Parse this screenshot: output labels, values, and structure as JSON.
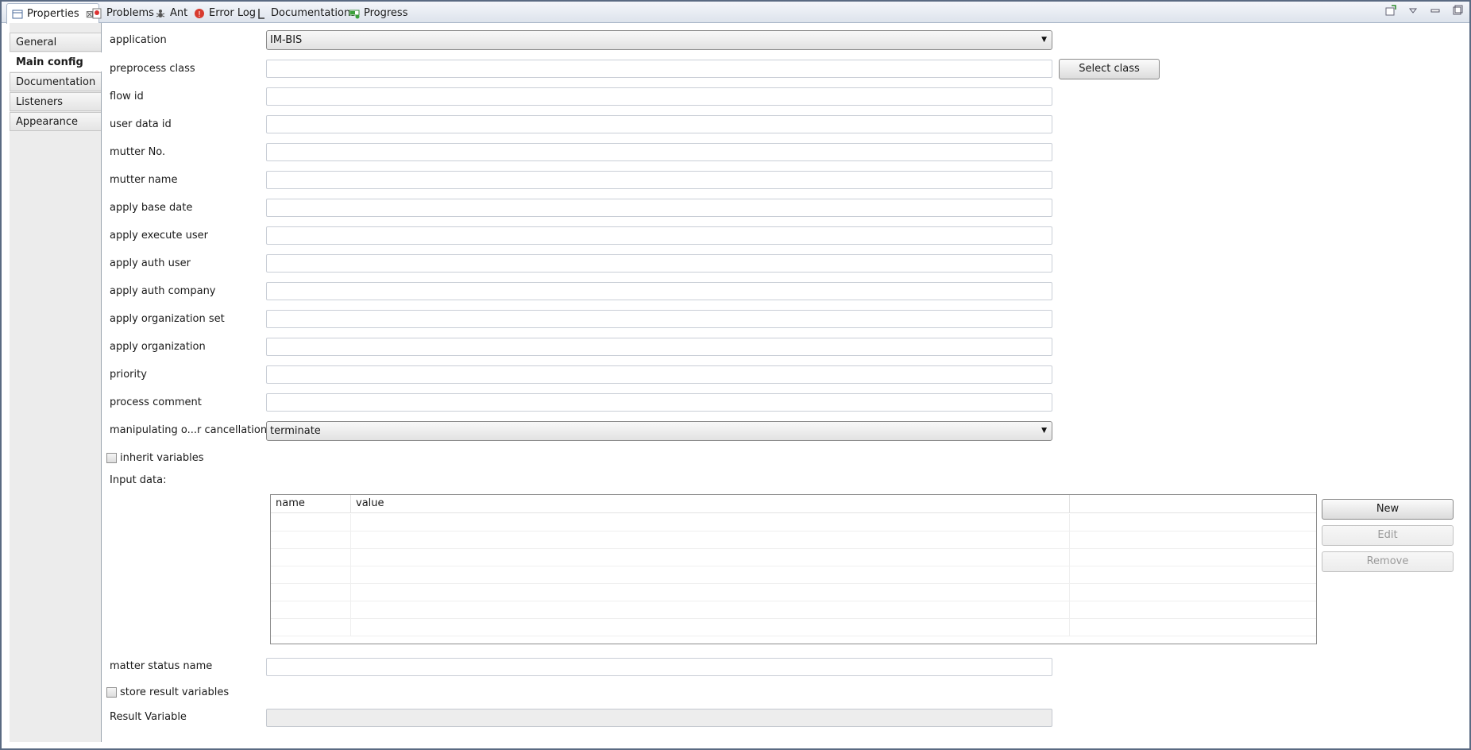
{
  "tabs": [
    {
      "label": "Properties",
      "icon": "properties-icon",
      "active": true
    },
    {
      "label": "Problems",
      "icon": "problems-icon"
    },
    {
      "label": "Ant",
      "icon": "ant-icon"
    },
    {
      "label": "Error Log",
      "icon": "error-log-icon"
    },
    {
      "label": "Documentations",
      "icon": "documentations-icon"
    },
    {
      "label": "Progress",
      "icon": "progress-icon"
    }
  ],
  "close_glyph": "⊠",
  "nav": {
    "items": [
      {
        "label": "General"
      },
      {
        "label": "Main config",
        "selected": true
      },
      {
        "label": "Documentation"
      },
      {
        "label": "Listeners"
      },
      {
        "label": "Appearance"
      }
    ]
  },
  "form": {
    "application_label": "application",
    "application_value": "IM-BIS",
    "preprocess_label": "preprocess class",
    "preprocess_value": "",
    "select_class_button": "Select class",
    "fields": [
      {
        "label": "flow id",
        "value": ""
      },
      {
        "label": "user data id",
        "value": ""
      },
      {
        "label": "mutter No.",
        "value": ""
      },
      {
        "label": "mutter name",
        "value": ""
      },
      {
        "label": "apply base date",
        "value": ""
      },
      {
        "label": "apply execute user",
        "value": ""
      },
      {
        "label": "apply auth user",
        "value": ""
      },
      {
        "label": "apply auth company",
        "value": ""
      },
      {
        "label": "apply organization set",
        "value": ""
      },
      {
        "label": "apply organization",
        "value": ""
      },
      {
        "label": "priority",
        "value": ""
      },
      {
        "label": "process comment",
        "value": ""
      }
    ],
    "cancellation_label": "manipulating o...r cancellation",
    "cancellation_value": "terminate",
    "inherit_label": "inherit variables",
    "inherit_checked": false,
    "input_data_label": "Input data:",
    "table": {
      "columns": [
        "name",
        "value",
        ""
      ],
      "rows": 7
    },
    "new_button": "New",
    "edit_button": "Edit",
    "remove_button": "Remove",
    "matter_status_label": "matter status name",
    "matter_status_value": "",
    "store_label": "store result variables",
    "store_checked": false,
    "result_label": "Result Variable",
    "result_value": ""
  },
  "colors": {
    "accent_border": "#5a6a82",
    "tab_border": "#a9b6c8",
    "nav_bg": "#ececec"
  }
}
